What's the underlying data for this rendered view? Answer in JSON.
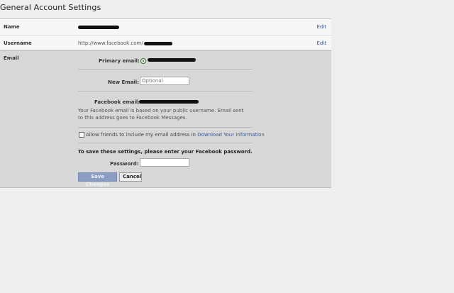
{
  "page": {
    "title": "General Account Settings"
  },
  "rows": {
    "name": {
      "label": "Name",
      "edit": "Edit"
    },
    "username": {
      "label": "Username",
      "value_prefix": "http://www.facebook.com/",
      "edit": "Edit"
    }
  },
  "email": {
    "label": "Email",
    "primary_label": "Primary email:",
    "new_email_label": "New Email:",
    "new_email_placeholder": "Optional",
    "facebook_email_label": "Facebook email:",
    "help_text": "Your Facebook email is based on your public username. Email sent to this address goes to Facebook Messages.",
    "allow_text": "Allow friends to include my email address in",
    "allow_link": "Download Your Information",
    "save_note": "To save these settings, please enter your Facebook password.",
    "password_label": "Password:",
    "save_button": "Save Changes",
    "cancel_button": "Cancel"
  }
}
